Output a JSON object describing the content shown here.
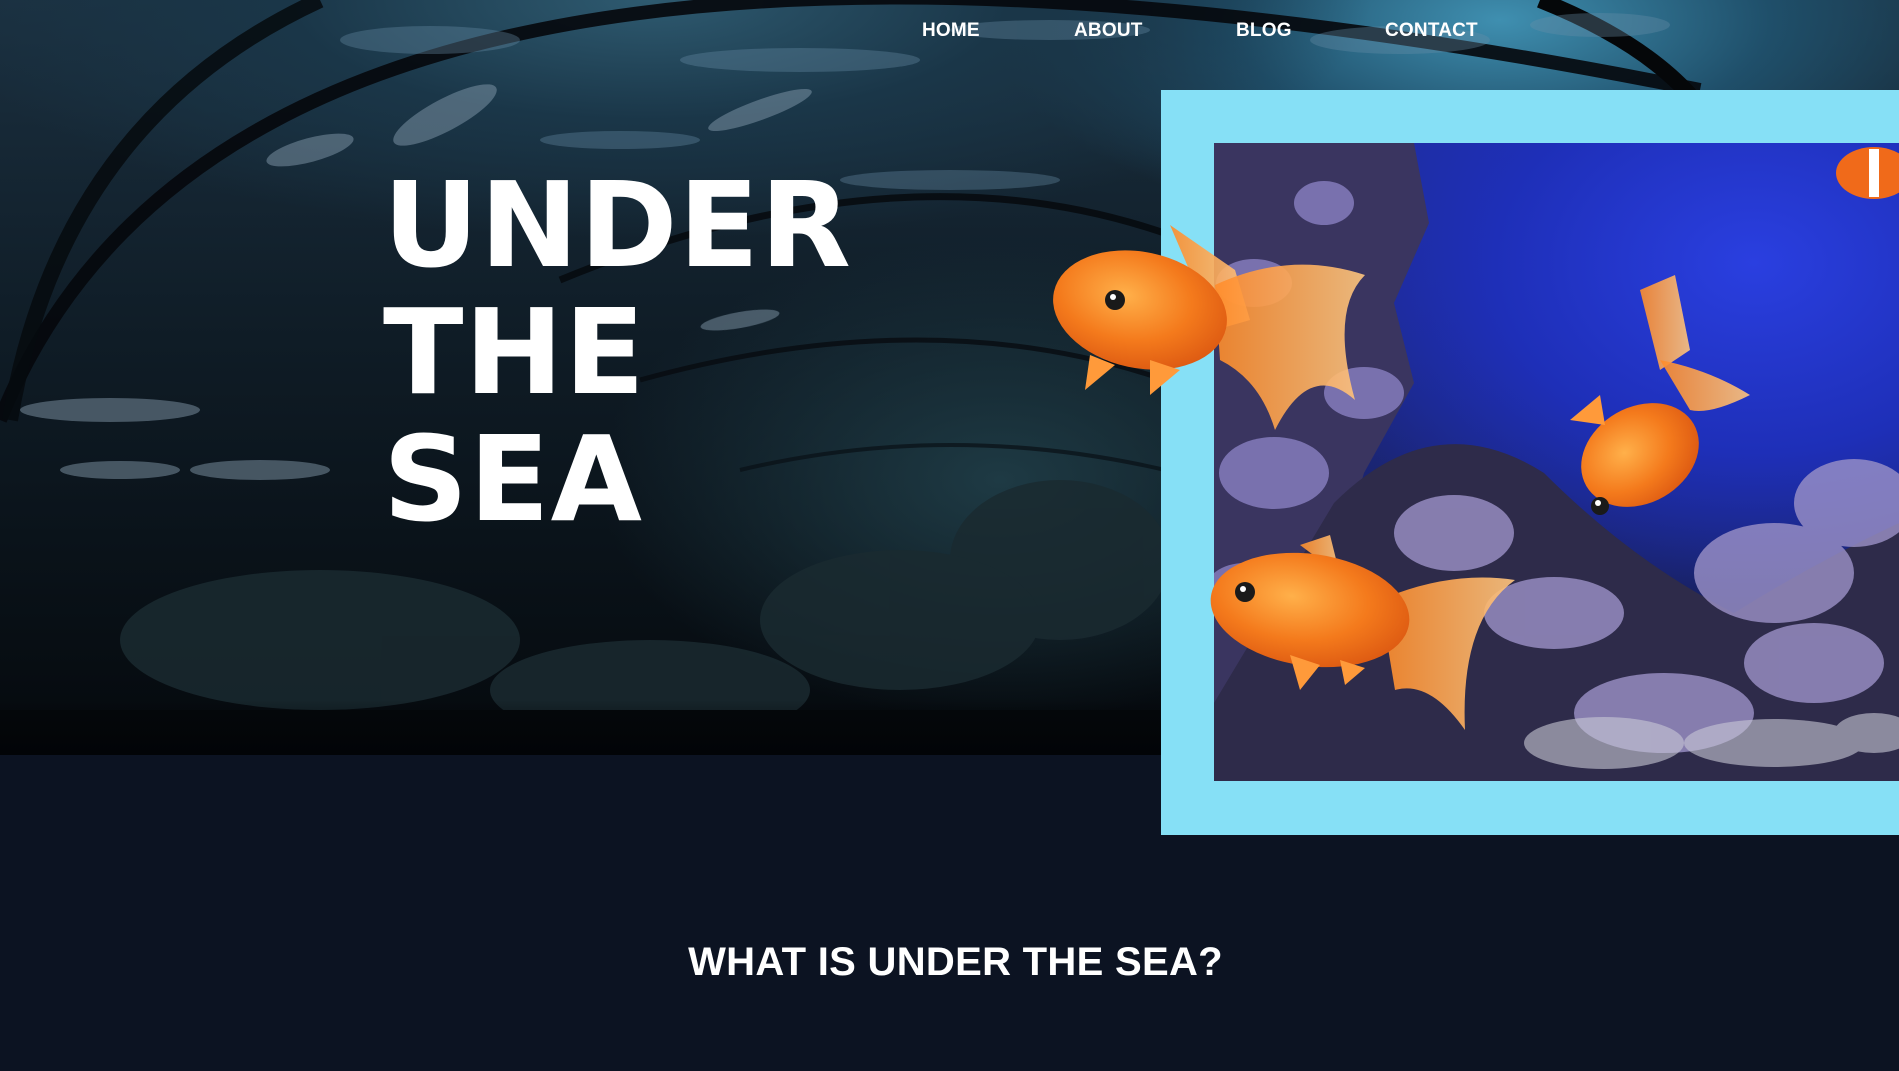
{
  "nav": {
    "items": [
      {
        "label": "HOME"
      },
      {
        "label": "ABOUT"
      },
      {
        "label": "BLOG"
      },
      {
        "label": "CONTACT"
      }
    ]
  },
  "hero": {
    "title_lines": [
      "UNDER",
      "THE",
      "SEA"
    ]
  },
  "section": {
    "heading": "WHAT IS UNDER THE SEA?"
  },
  "colors": {
    "frame": "#86e0f6",
    "page_background": "#0c1322",
    "text": "#ffffff",
    "goldfish": "#f47a1c"
  },
  "images": {
    "hero_background": "underwater-tunnel-aquarium",
    "framed_photo": "aquarium-goldfish-coral-reef"
  }
}
